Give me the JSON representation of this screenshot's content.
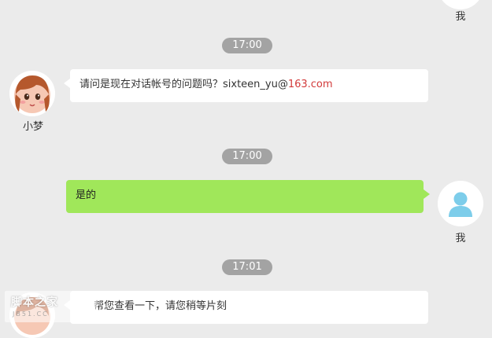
{
  "messages": [
    {
      "type": "time",
      "text": "17:00"
    },
    {
      "type": "agent",
      "name": "小梦",
      "text_prefix": "请问是现在对话帐号的问题吗？sixteen_yu@",
      "text_link": "163.com"
    },
    {
      "type": "time",
      "text": "17:00"
    },
    {
      "type": "user",
      "name": "我",
      "text": "是的"
    },
    {
      "type": "time",
      "text": "17:01"
    },
    {
      "type": "agent",
      "text": "帮您查看一下，请您稍等片刻"
    }
  ],
  "top_user": {
    "name": "我"
  },
  "watermark": {
    "title": "脚本之家",
    "subtitle": "JB51.CC"
  },
  "colors": {
    "background": "#ebebeb",
    "user_bubble": "#a0e75a",
    "time_pill": "#a3a3a3",
    "link": "#d23a3a",
    "user_avatar": "#7dcdea"
  }
}
